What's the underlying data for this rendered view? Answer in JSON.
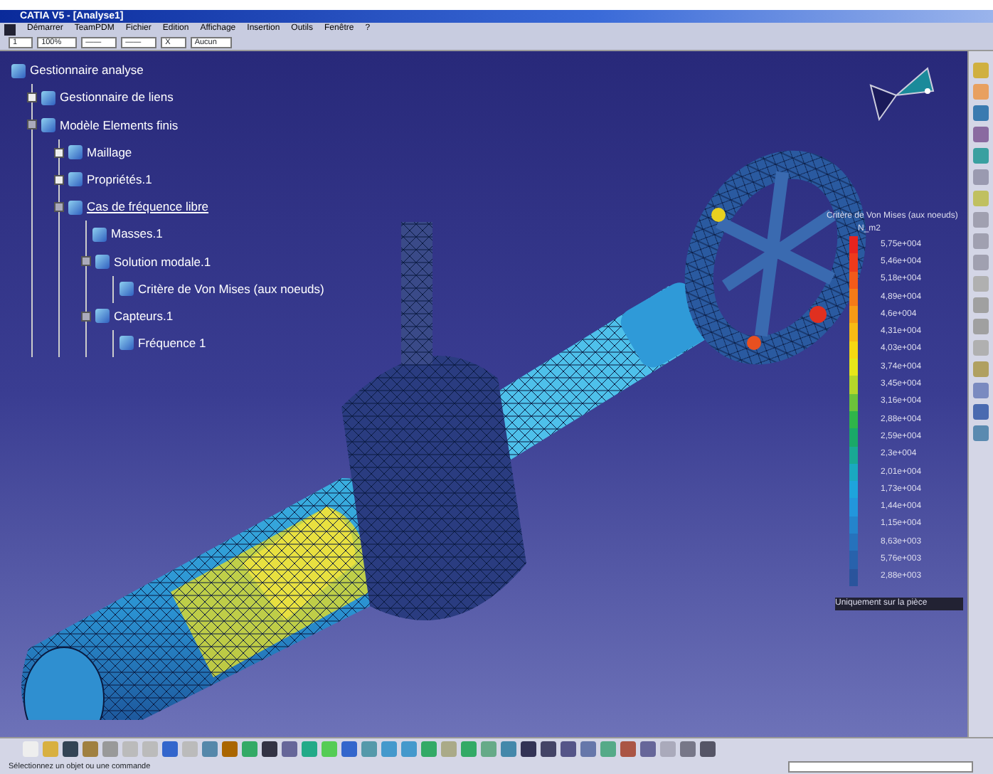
{
  "window": {
    "title": "CATIA V5 - [Analyse1]"
  },
  "menu": [
    "Démarrer",
    "TeamPDM",
    "Fichier",
    "Edition",
    "Affichage",
    "Insertion",
    "Outils",
    "Fenêtre",
    "?"
  ],
  "format_toolbar": [
    "1",
    "100%",
    "——",
    "——",
    "X",
    "Aucun"
  ],
  "tree": [
    {
      "label": "Gestionnaire analyse",
      "active": false,
      "children": [
        {
          "label": "Gestionnaire de liens",
          "active": false,
          "expanded": false
        },
        {
          "label": "Modèle Elements finis",
          "active": false,
          "expanded": true,
          "children": [
            {
              "label": "Maillage",
              "active": false,
              "expanded": false
            },
            {
              "label": "Propriétés.1",
              "active": false,
              "expanded": false
            },
            {
              "label": "Cas de fréquence libre",
              "active": true,
              "expanded": true,
              "children": [
                {
                  "label": "Masses.1",
                  "active": false
                },
                {
                  "label": "Solution modale.1",
                  "active": false,
                  "expanded": true,
                  "children": [
                    {
                      "label": "Critère de Von Mises (aux noeuds)",
                      "active": false
                    }
                  ]
                },
                {
                  "label": "Capteurs.1",
                  "active": false,
                  "expanded": true,
                  "children": [
                    {
                      "label": "Fréquence 1",
                      "active": false
                    }
                  ]
                }
              ]
            }
          ]
        }
      ]
    }
  ],
  "legend": {
    "title": "Critère de Von Mises (aux noeuds)",
    "unit": "N_m2",
    "footer": "Uniquement sur la pièce",
    "entries": [
      {
        "value": "5,75e+004",
        "color": "#e8231e"
      },
      {
        "value": "5,46e+004",
        "color": "#ee3a1c"
      },
      {
        "value": "5,18e+004",
        "color": "#f25a1a"
      },
      {
        "value": "4,89e+004",
        "color": "#f47a18"
      },
      {
        "value": "4,6e+004",
        "color": "#f69a16"
      },
      {
        "value": "4,31e+004",
        "color": "#f8bb14"
      },
      {
        "value": "4,03e+004",
        "color": "#f5d812"
      },
      {
        "value": "3,74e+004",
        "color": "#e6e61a"
      },
      {
        "value": "3,45e+004",
        "color": "#b4d62a"
      },
      {
        "value": "3,16e+004",
        "color": "#6cc23a"
      },
      {
        "value": "2,88e+004",
        "color": "#2fb44a"
      },
      {
        "value": "2,59e+004",
        "color": "#1aa868"
      },
      {
        "value": "2,3e+004",
        "color": "#19a894"
      },
      {
        "value": "2,01e+004",
        "color": "#1aa8c0"
      },
      {
        "value": "1,73e+004",
        "color": "#1ea4dc"
      },
      {
        "value": "1,44e+004",
        "color": "#2296dc"
      },
      {
        "value": "1,15e+004",
        "color": "#2484cc"
      },
      {
        "value": "8,63e+003",
        "color": "#2672bc"
      },
      {
        "value": "5,76e+003",
        "color": "#2862ac"
      },
      {
        "value": "2,88e+003",
        "color": "#2a549c"
      }
    ]
  },
  "status_bar": {
    "message": "Sélectionnez un objet ou une commande"
  }
}
